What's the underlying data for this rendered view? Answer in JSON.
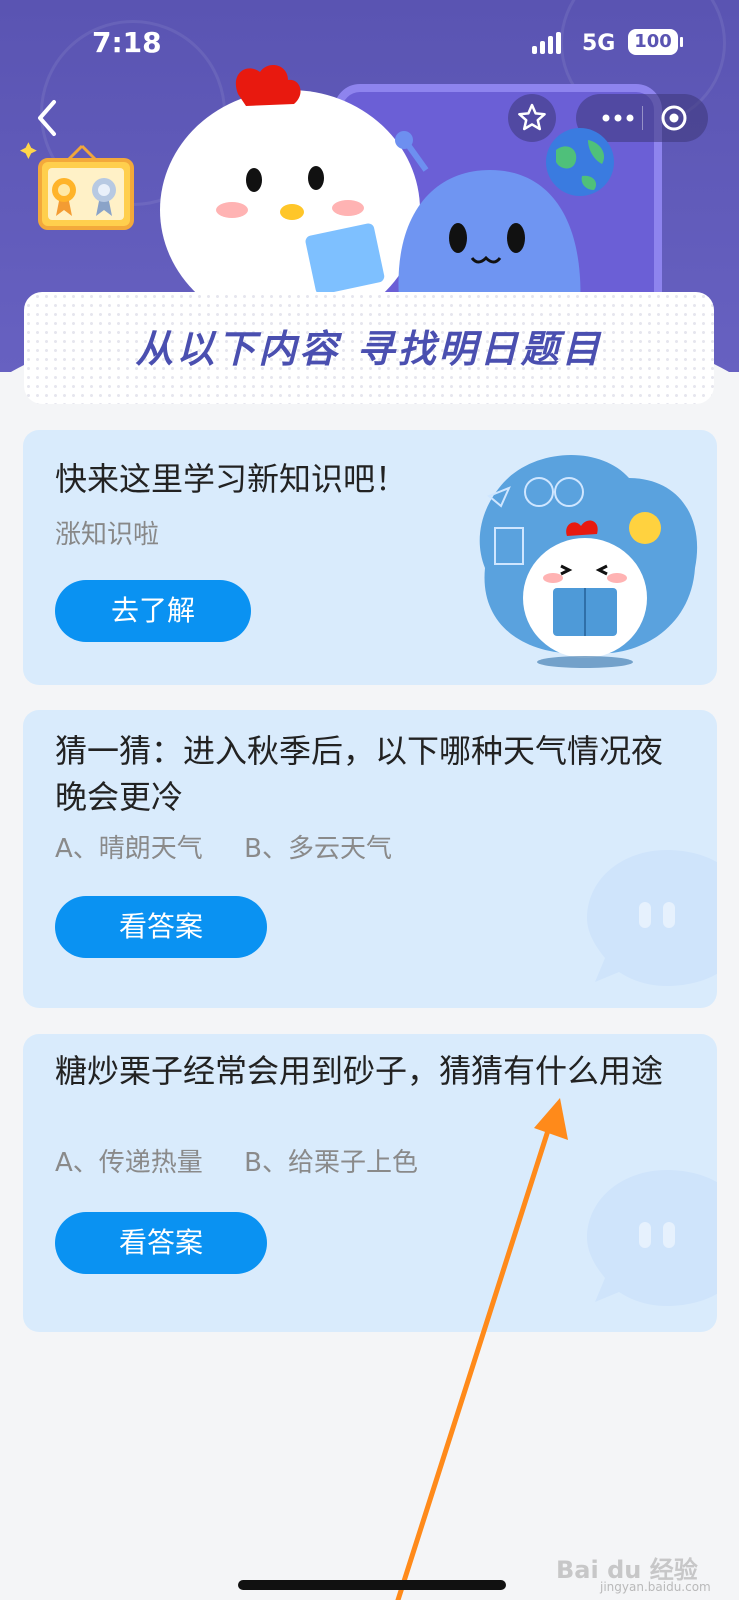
{
  "status_bar": {
    "time": "7:18",
    "network": "5G",
    "battery": "100"
  },
  "banner": {
    "title": "从以下内容 寻找明日题目"
  },
  "cards": [
    {
      "title": "快来这里学习新知识吧！",
      "subtitle": "涨知识啦",
      "button": "去了解"
    },
    {
      "title": "猜一猜：进入秋季后，以下哪种天气情况夜晚会更冷",
      "options": "A、晴朗天气     B、多云天气",
      "button": "看答案"
    },
    {
      "title": "糖炒栗子经常会用到砂子，猜猜有什么用途",
      "options": "A、传递热量     B、给栗子上色",
      "button": "看答案"
    }
  ],
  "watermark": {
    "text": "Bai du 经验",
    "sub": "jingyan.baidu.com"
  },
  "colors": {
    "header": "#5a54b2",
    "card": "#d9ebfc",
    "button": "#0a92f2",
    "arrow": "#ff8a1a"
  },
  "icons": [
    "back-icon",
    "star-icon",
    "more-icon",
    "target-icon",
    "medal-icon",
    "chick-mascot",
    "alien-mascot",
    "planet-icon",
    "speech-bubble-icon"
  ]
}
